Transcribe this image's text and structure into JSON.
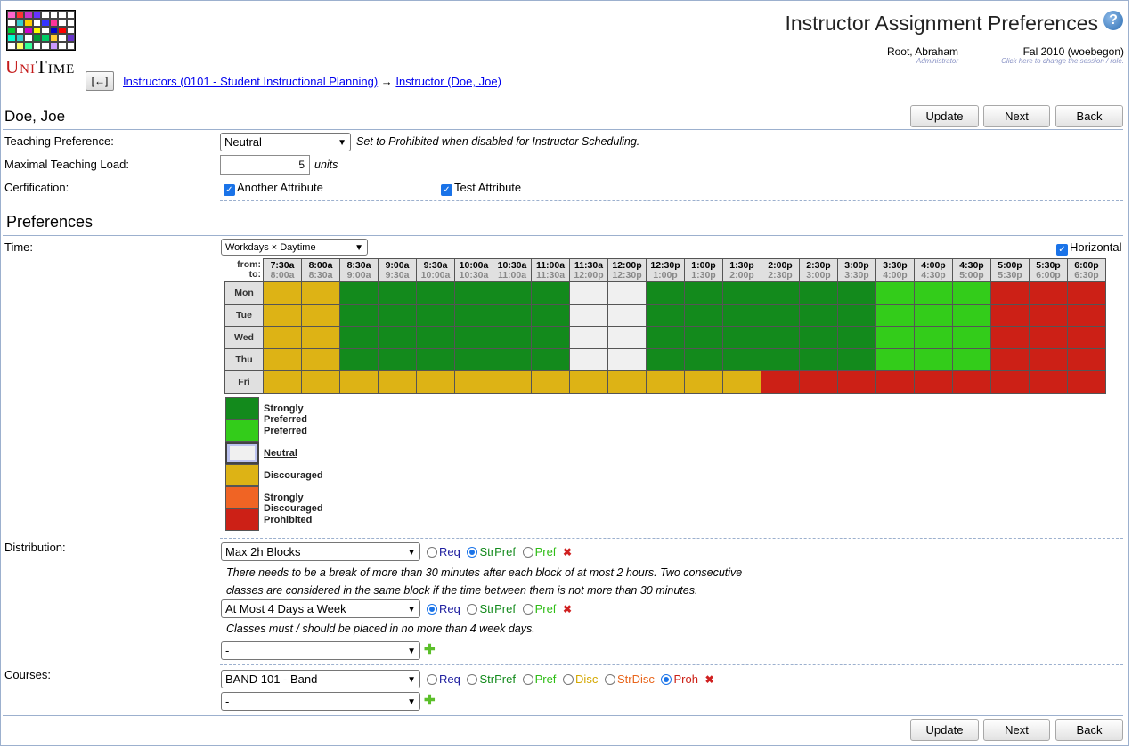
{
  "header": {
    "title": "Instructor Assignment Preferences",
    "logo_text_1": "U",
    "logo_text_2": "NI",
    "logo_text_3": "T",
    "logo_text_4": "IME",
    "help_icon": "?",
    "user_name": "Root, Abraham",
    "user_role": "Administrator",
    "session": "Fal 2010 (woebegon)",
    "session_hint": "Click here to change the session / role."
  },
  "nav": {
    "back_label": "[←]",
    "crumb_1": "Instructors (0101 - Student Instructional Planning)",
    "arrow": "→",
    "crumb_2": "Instructor (Doe, Joe)"
  },
  "instructor_name": "Doe, Joe",
  "buttons": {
    "update": "Update",
    "next": "Next",
    "back": "Back"
  },
  "form": {
    "teaching_pref_label": "Teaching Preference:",
    "teaching_pref_value": "Neutral",
    "teaching_pref_note": "Set to Prohibited when disabled for Instructor Scheduling.",
    "max_load_label": "Maximal Teaching Load:",
    "max_load_value": "5",
    "max_load_unit": "units",
    "cert_label": "Cerfification:",
    "cert_1": "Another Attribute",
    "cert_2": "Test Attribute"
  },
  "preferences_title": "Preferences",
  "time": {
    "label": "Time:",
    "pattern": "Workdays × Daytime",
    "horizontal_label": "Horizontal",
    "from_label": "from:",
    "to_label": "to:",
    "slots_from": [
      "7:30a",
      "8:00a",
      "8:30a",
      "9:00a",
      "9:30a",
      "10:00a",
      "10:30a",
      "11:00a",
      "11:30a",
      "12:00p",
      "12:30p",
      "1:00p",
      "1:30p",
      "2:00p",
      "2:30p",
      "3:00p",
      "3:30p",
      "4:00p",
      "4:30p",
      "5:00p",
      "5:30p",
      "6:00p"
    ],
    "slots_to": [
      "8:00a",
      "8:30a",
      "9:00a",
      "9:30a",
      "10:00a",
      "10:30a",
      "11:00a",
      "11:30a",
      "12:00p",
      "12:30p",
      "1:00p",
      "1:30p",
      "2:00p",
      "2:30p",
      "3:00p",
      "3:30p",
      "4:00p",
      "4:30p",
      "5:00p",
      "5:30p",
      "6:00p",
      "6:30p"
    ],
    "days": [
      "Mon",
      "Tue",
      "Wed",
      "Thu",
      "Fri"
    ],
    "grid": [
      [
        "D",
        "D",
        "R",
        "R",
        "R",
        "R",
        "R",
        "R",
        "N",
        "N",
        "R",
        "R",
        "R",
        "R",
        "R",
        "R",
        "P",
        "P",
        "P",
        "X",
        "X",
        "X"
      ],
      [
        "D",
        "D",
        "R",
        "R",
        "R",
        "R",
        "R",
        "R",
        "N",
        "N",
        "R",
        "R",
        "R",
        "R",
        "R",
        "R",
        "P",
        "P",
        "P",
        "X",
        "X",
        "X"
      ],
      [
        "D",
        "D",
        "R",
        "R",
        "R",
        "R",
        "R",
        "R",
        "N",
        "N",
        "R",
        "R",
        "R",
        "R",
        "R",
        "R",
        "P",
        "P",
        "P",
        "X",
        "X",
        "X"
      ],
      [
        "D",
        "D",
        "R",
        "R",
        "R",
        "R",
        "R",
        "R",
        "N",
        "N",
        "R",
        "R",
        "R",
        "R",
        "R",
        "R",
        "P",
        "P",
        "P",
        "X",
        "X",
        "X"
      ],
      [
        "D",
        "D",
        "D",
        "D",
        "D",
        "D",
        "D",
        "D",
        "D",
        "D",
        "D",
        "D",
        "D",
        "X",
        "X",
        "X",
        "X",
        "X",
        "X",
        "X",
        "X",
        "X"
      ]
    ],
    "colors": {
      "R": "#138a1c",
      "P": "#33cc1a",
      "N": "#f0f0f0",
      "D": "#ddb315",
      "S": "#f06424",
      "X": "#cc2016"
    },
    "legend": [
      {
        "code": "R",
        "label": "Strongly Preferred"
      },
      {
        "code": "P",
        "label": "Preferred"
      },
      {
        "code": "N",
        "label": "Neutral"
      },
      {
        "code": "D",
        "label": "Discouraged"
      },
      {
        "code": "S",
        "label": "Strongly Discouraged"
      },
      {
        "code": "X",
        "label": "Prohibited"
      }
    ]
  },
  "distribution": {
    "label": "Distribution:",
    "item1": {
      "value": "Max 2h Blocks",
      "desc": "There needs to be a break of more than 30 minutes after each block of at most 2 hours. Two consecutive classes are considered in the same block if the time between them is not more than 30 minutes.",
      "selected": "StrPref"
    },
    "item2": {
      "value": "At Most 4 Days a Week",
      "desc": "Classes must / should be placed in no more than 4 week days.",
      "selected": "Req"
    },
    "empty_value": "-",
    "options": {
      "req": "Req",
      "strpref": "StrPref",
      "pref": "Pref"
    }
  },
  "courses": {
    "label": "Courses:",
    "value": "BAND 101 - Band",
    "empty_value": "-",
    "options": {
      "req": "Req",
      "strpref": "StrPref",
      "pref": "Pref",
      "disc": "Disc",
      "strdisc": "StrDisc",
      "proh": "Proh"
    },
    "selected": "Proh"
  },
  "icons": {
    "close": "delete-icon",
    "add": "add-icon",
    "check": "✓",
    "chevron": "⌄"
  },
  "pref_colors": {
    "req": "#2020a0",
    "strpref": "#138a1c",
    "pref": "#2ebd15",
    "disc": "#d4a800",
    "strdisc": "#e8641a",
    "proh": "#cc2016"
  }
}
